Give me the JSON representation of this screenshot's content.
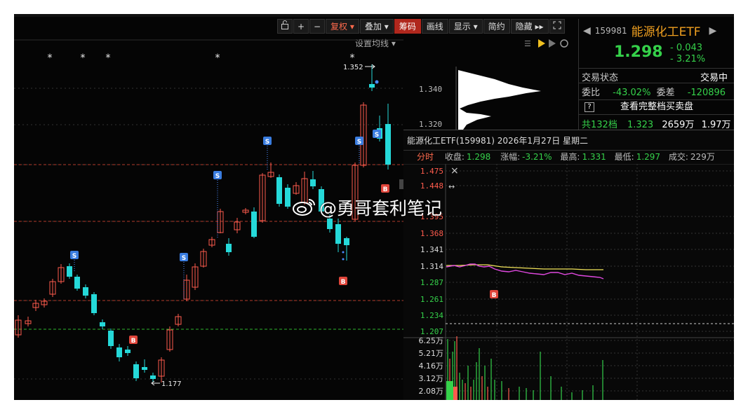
{
  "toolbar": {
    "lock_icon": "lock-icon",
    "zoom_in": "+",
    "zoom_out": "−",
    "fuquan": "复权",
    "diejia": "叠加",
    "chouma": "筹码",
    "huaxian": "画线",
    "xianshi": "显示",
    "jianyue": "简约",
    "yincang": "隐藏",
    "fullscreen_icon": "expand-icon"
  },
  "chart": {
    "setting_label": "设置均线",
    "high_label": "1.352",
    "low_label": "1.177",
    "signal_s": "S",
    "signal_b": "B",
    "star": "*"
  },
  "chips_axis": [
    "1.340",
    "1.320"
  ],
  "quote": {
    "code": "159981",
    "name": "能源化工ETF",
    "price": "1.298",
    "change": "- 0.043",
    "change_pct": "- 3.21%",
    "status_label": "交易状态",
    "status_value": "交易中",
    "weibi_label": "委比",
    "weibi_value": "-43.02%",
    "weicha_label": "委差",
    "weicha_value": "-120896",
    "full_book": "查看完整档买卖盘",
    "levels_label": "共132档",
    "levels_price": "1.323",
    "levels_amount": "2659万",
    "levels_vol": "1.97万"
  },
  "popup": {
    "title": "能源化工ETF(159981) 2026年1月27日 星期二",
    "tab": "分时",
    "close_label": "收盘:",
    "close_value": "1.298",
    "pct_label": "涨幅:",
    "pct_value": "-3.21%",
    "high_label": "最高:",
    "high_value": "1.331",
    "low_label": "最低:",
    "low_value": "1.297",
    "vol_label": "成交:",
    "vol_value": "229万",
    "price_axis": [
      "1.475",
      "1.448",
      "1.395",
      "1.368",
      "1.341",
      "1.314",
      "1.287",
      "1.261",
      "1.234",
      "1.207"
    ],
    "vol_axis": [
      "6.25万",
      "5.21万",
      "4.16万",
      "3.12万",
      "2.08万"
    ],
    "marker_b": "B"
  },
  "watermark": "@勇哥套利笔记",
  "colors": {
    "up": "#ff5b4d",
    "down": "#25d9d9",
    "green": "#35d14a",
    "accent": "#f0a020"
  }
}
